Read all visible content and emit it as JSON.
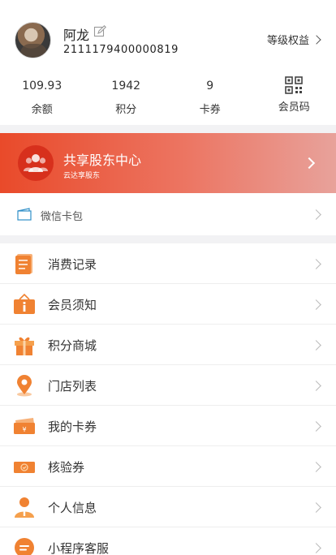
{
  "profile": {
    "nickname": "阿龙",
    "member_no": "2111179400000819",
    "level_link": "等级权益"
  },
  "stats": [
    {
      "value": "109.93",
      "label": "余额"
    },
    {
      "value": "1942",
      "label": "积分"
    },
    {
      "value": "9",
      "label": "卡券"
    },
    {
      "value": "",
      "label": "会员码",
      "icon": "qr-code-icon"
    }
  ],
  "banner": {
    "title": "共享股东中心",
    "subtitle": "云达享股东",
    "icon": "shareholders-icon"
  },
  "wechat_card": {
    "label": "微信卡包",
    "icon": "card-wallet-icon"
  },
  "menu": [
    {
      "label": "消费记录",
      "icon": "record-list-icon"
    },
    {
      "label": "会员须知",
      "icon": "info-board-icon"
    },
    {
      "label": "积分商城",
      "icon": "gift-box-icon"
    },
    {
      "label": "门店列表",
      "icon": "location-pin-icon"
    },
    {
      "label": "我的卡券",
      "icon": "coupon-ticket-icon"
    },
    {
      "label": "核验券",
      "icon": "verify-ticket-icon"
    },
    {
      "label": "个人信息",
      "icon": "person-icon"
    },
    {
      "label": "小程序客服",
      "icon": "chat-bubble-icon"
    }
  ],
  "colors": {
    "accent": "#f08232",
    "banner_start": "#e94a2a",
    "banner_end": "#e8a29b",
    "divider": "#f2f2f4"
  }
}
